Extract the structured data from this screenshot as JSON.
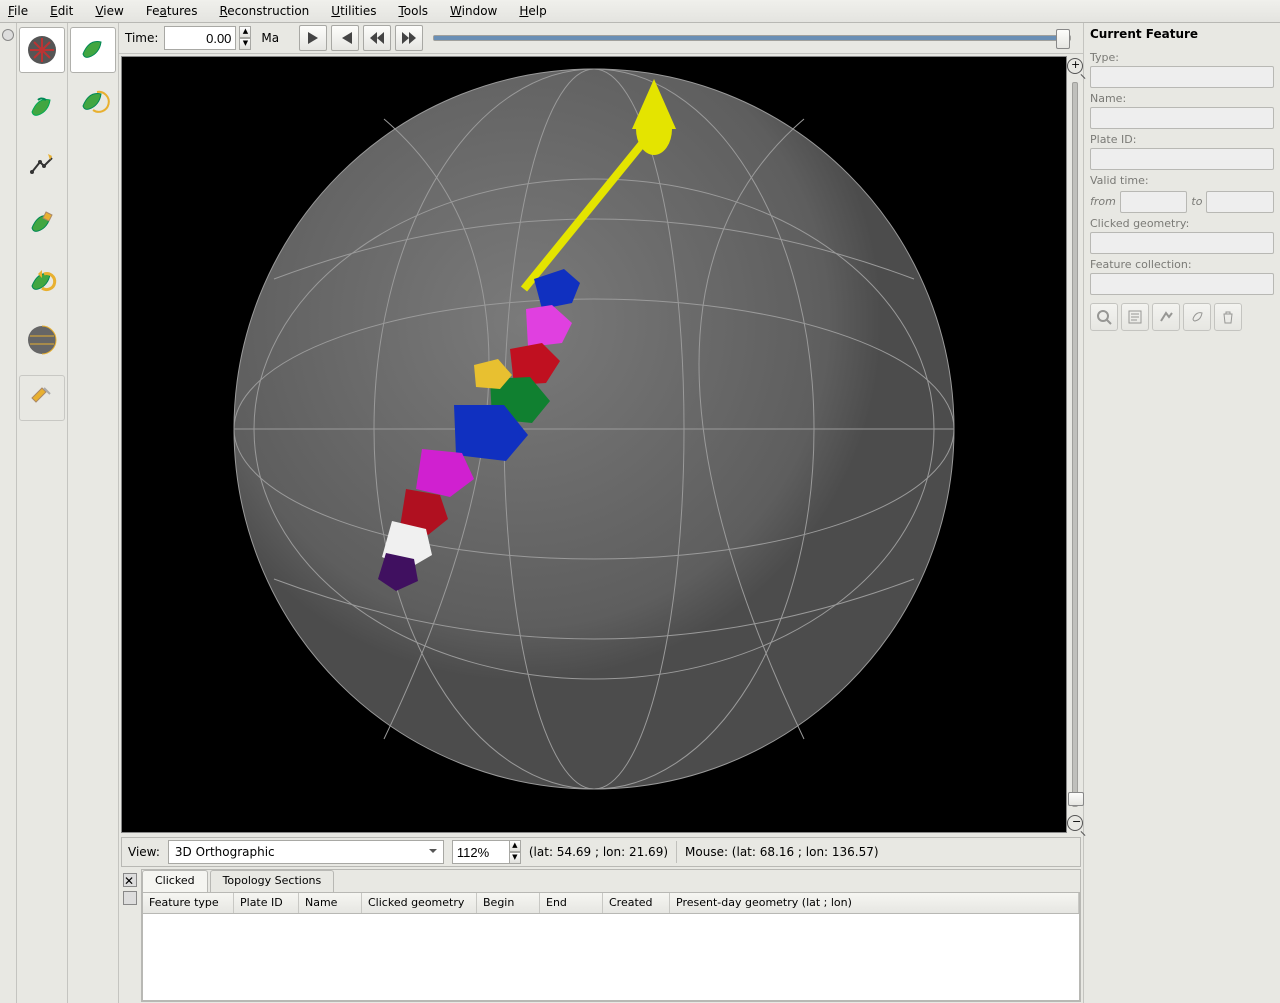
{
  "menu": {
    "file": "File",
    "edit": "Edit",
    "view": "View",
    "features": "Features",
    "reconstruction": "Reconstruction",
    "utilities": "Utilities",
    "tools": "Tools",
    "window": "Window",
    "help": "Help"
  },
  "time": {
    "label": "Time:",
    "value": "0.00",
    "unit": "Ma"
  },
  "viewbar": {
    "label": "View:",
    "projection": "3D Orthographic",
    "zoom": "112%",
    "centre": "(lat: 54.69 ; lon: 21.69)",
    "mouse": "Mouse: (lat: 68.16 ; lon: 136.57)"
  },
  "tabs": {
    "clicked": "Clicked",
    "topology": "Topology Sections"
  },
  "columns": {
    "feature_type": "Feature type",
    "plate_id": "Plate ID",
    "name": "Name",
    "clicked_geom": "Clicked geometry",
    "begin": "Begin",
    "end": "End",
    "created": "Created",
    "present": "Present-day geometry (lat ; lon)"
  },
  "panel": {
    "title": "Current Feature",
    "type": "Type:",
    "name": "Name:",
    "plate_id": "Plate ID:",
    "valid_time": "Valid time:",
    "from": "from",
    "to": "to",
    "clicked_geom": "Clicked geometry:",
    "collection": "Feature collection:"
  },
  "icons": {
    "play": "play",
    "reset": "reset",
    "step_back": "step-back",
    "step_fwd": "step-forward"
  }
}
